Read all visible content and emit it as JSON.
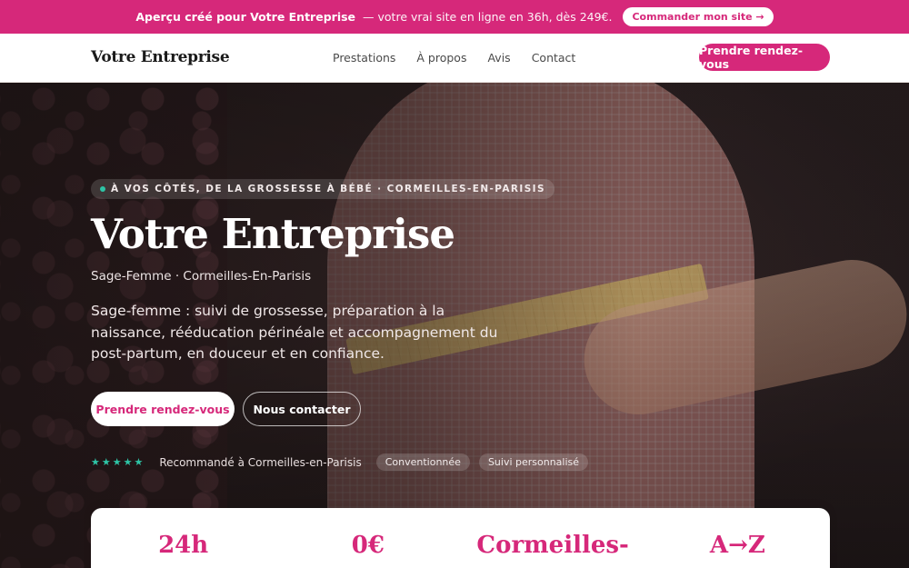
{
  "promo": {
    "bold_text": "Aperçu créé pour Votre Entreprise",
    "text": "— votre vrai site en ligne en 36h, dès 249€.",
    "cta": "Commander mon site →"
  },
  "header": {
    "brand": "Votre Entreprise",
    "nav": [
      "Prestations",
      "À propos",
      "Avis",
      "Contact"
    ],
    "cta": "Prendre rendez-vous"
  },
  "hero": {
    "eyebrow": "À VOS CÔTÉS, DE LA GROSSESSE À BÉBÉ · CORMEILLES-EN-PARISIS",
    "title": "Votre Entreprise",
    "subtitle": "Sage-Femme · Cormeilles-En-Parisis",
    "description": "Sage-femme : suivi de grossesse, préparation à la naissance, rééducation périnéale et accompagnement du post-partum, en douceur et en confiance.",
    "primary_button": "Prendre rendez-vous",
    "secondary_button": "Nous contacter",
    "stars": "★★★★★",
    "recommendation": "Recommandé à Cormeilles-en-Parisis",
    "chips": [
      "Conventionnée",
      "Suivi personnalisé"
    ]
  },
  "stats": [
    "24h",
    "0€",
    "Cormeilles-",
    "A→Z"
  ],
  "colors": {
    "accent": "#d6287a",
    "star": "#2ec4a6"
  }
}
